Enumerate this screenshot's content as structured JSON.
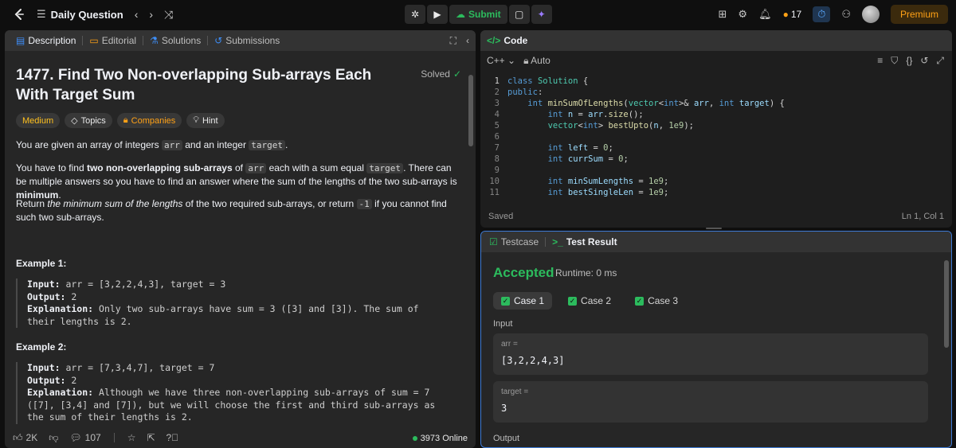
{
  "topbar": {
    "title": "Daily Question",
    "submit_label": "Submit",
    "streak": "17",
    "premium_label": "Premium"
  },
  "left": {
    "tabs": [
      "Description",
      "Editorial",
      "Solutions",
      "Submissions"
    ],
    "problem_title": "1477. Find Two Non-overlapping Sub-arrays Each With Target Sum",
    "solved_label": "Solved",
    "chips": [
      "Medium",
      "Topics",
      "Companies",
      "Hint"
    ],
    "p1": {
      "a": "You are given an array of integers ",
      "b": "arr",
      "c": " and an integer ",
      "d": "target",
      "e": "."
    },
    "p2": {
      "a": "You have to find ",
      "b": "two non-overlapping sub-arrays",
      "c": " of ",
      "d": "arr",
      "e": " each with a sum equal ",
      "f": "target",
      "g": ". There can be multiple answers so you have to find an answer where the sum of the lengths of the two sub-arrays is ",
      "h": "minimum",
      "i": "."
    },
    "p3": {
      "a": "Return ",
      "b": "the minimum sum of the lengths",
      "c": " of the two required sub-arrays, or return ",
      "d": "-1",
      "e": " if you cannot find such two sub-arrays."
    },
    "example1": {
      "heading": "Example 1:",
      "input_label": "Input:",
      "input": "arr = [3,2,2,4,3], target = 3",
      "output_label": "Output:",
      "output": "2",
      "expl_label": "Explanation:",
      "expl": "Only two sub-arrays have sum = 3 ([3] and [3]). The sum of their lengths is 2."
    },
    "example2": {
      "heading": "Example 2:",
      "input_label": "Input:",
      "input": "arr = [7,3,4,7], target = 7",
      "output_label": "Output:",
      "output": "2",
      "expl_label": "Explanation:",
      "expl": "Although we have three non-overlapping sub-arrays of sum = 7 ([7], [3,4] and [7]), but we will choose the first and third sub-arrays as the sum of their lengths is 2."
    },
    "footer": {
      "likes": "2K",
      "comments": "107",
      "online": "3973 Online"
    }
  },
  "code": {
    "tab_label": "Code",
    "language": "C++",
    "mode": "Auto",
    "status": "Saved",
    "cursor": "Ln 1, Col 1"
  },
  "result": {
    "tabs": [
      "Testcase",
      "Test Result"
    ],
    "verdict": "Accepted",
    "runtime": "Runtime: 0 ms",
    "cases": [
      "Case 1",
      "Case 2",
      "Case 3"
    ],
    "input_label": "Input",
    "var1_name": "arr =",
    "var1_value": "[3,2,2,4,3]",
    "var2_name": "target =",
    "var2_value": "3",
    "output_label": "Output"
  }
}
